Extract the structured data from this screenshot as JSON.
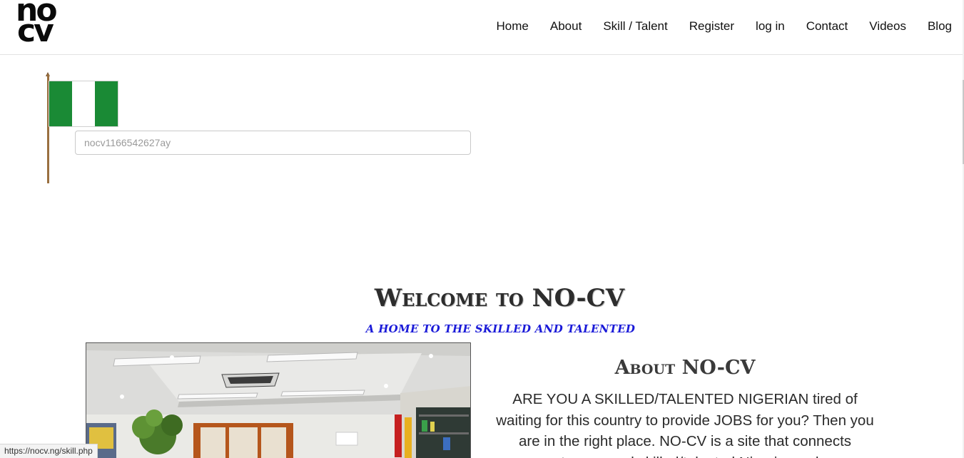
{
  "header": {
    "logo": {
      "line1": "no",
      "line2": "cv"
    },
    "nav": [
      "Home",
      "About",
      "Skill / Talent",
      "Register",
      "log in",
      "Contact",
      "Videos",
      "Blog"
    ]
  },
  "flag": {
    "colors": [
      "#1a8a35",
      "#ffffff",
      "#1a8a35"
    ]
  },
  "code_field": {
    "placeholder": "nocv1166542627ay"
  },
  "welcome": {
    "title": "Welcome to NO-CV",
    "subtitle": "A HOME TO THE SKILLED AND TALENTED"
  },
  "about": {
    "title": "About NO-CV",
    "text": "ARE YOU A SKILLED/TALENTED NIGERIAN tired of waiting for this country to provide JOBS for you? Then you are in the right place. NO-CV is a site that connects customers and skilled/talented Nigerians who"
  },
  "status_url": "https://nocv.ng/skill.php",
  "colors": {
    "subtitle_blue": "#1a1ad8",
    "flag_green": "#1a8a35"
  }
}
